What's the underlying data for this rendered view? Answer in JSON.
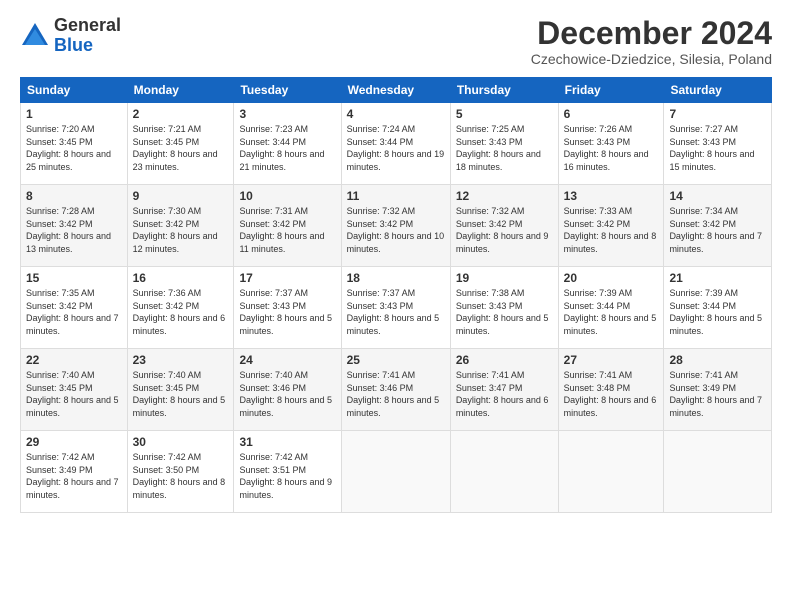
{
  "header": {
    "logo_general": "General",
    "logo_blue": "Blue",
    "month_title": "December 2024",
    "location": "Czechowice-Dziedzice, Silesia, Poland"
  },
  "days_of_week": [
    "Sunday",
    "Monday",
    "Tuesday",
    "Wednesday",
    "Thursday",
    "Friday",
    "Saturday"
  ],
  "weeks": [
    [
      {
        "day": "1",
        "sunrise": "Sunrise: 7:20 AM",
        "sunset": "Sunset: 3:45 PM",
        "daylight": "Daylight: 8 hours and 25 minutes."
      },
      {
        "day": "2",
        "sunrise": "Sunrise: 7:21 AM",
        "sunset": "Sunset: 3:45 PM",
        "daylight": "Daylight: 8 hours and 23 minutes."
      },
      {
        "day": "3",
        "sunrise": "Sunrise: 7:23 AM",
        "sunset": "Sunset: 3:44 PM",
        "daylight": "Daylight: 8 hours and 21 minutes."
      },
      {
        "day": "4",
        "sunrise": "Sunrise: 7:24 AM",
        "sunset": "Sunset: 3:44 PM",
        "daylight": "Daylight: 8 hours and 19 minutes."
      },
      {
        "day": "5",
        "sunrise": "Sunrise: 7:25 AM",
        "sunset": "Sunset: 3:43 PM",
        "daylight": "Daylight: 8 hours and 18 minutes."
      },
      {
        "day": "6",
        "sunrise": "Sunrise: 7:26 AM",
        "sunset": "Sunset: 3:43 PM",
        "daylight": "Daylight: 8 hours and 16 minutes."
      },
      {
        "day": "7",
        "sunrise": "Sunrise: 7:27 AM",
        "sunset": "Sunset: 3:43 PM",
        "daylight": "Daylight: 8 hours and 15 minutes."
      }
    ],
    [
      {
        "day": "8",
        "sunrise": "Sunrise: 7:28 AM",
        "sunset": "Sunset: 3:42 PM",
        "daylight": "Daylight: 8 hours and 13 minutes."
      },
      {
        "day": "9",
        "sunrise": "Sunrise: 7:30 AM",
        "sunset": "Sunset: 3:42 PM",
        "daylight": "Daylight: 8 hours and 12 minutes."
      },
      {
        "day": "10",
        "sunrise": "Sunrise: 7:31 AM",
        "sunset": "Sunset: 3:42 PM",
        "daylight": "Daylight: 8 hours and 11 minutes."
      },
      {
        "day": "11",
        "sunrise": "Sunrise: 7:32 AM",
        "sunset": "Sunset: 3:42 PM",
        "daylight": "Daylight: 8 hours and 10 minutes."
      },
      {
        "day": "12",
        "sunrise": "Sunrise: 7:32 AM",
        "sunset": "Sunset: 3:42 PM",
        "daylight": "Daylight: 8 hours and 9 minutes."
      },
      {
        "day": "13",
        "sunrise": "Sunrise: 7:33 AM",
        "sunset": "Sunset: 3:42 PM",
        "daylight": "Daylight: 8 hours and 8 minutes."
      },
      {
        "day": "14",
        "sunrise": "Sunrise: 7:34 AM",
        "sunset": "Sunset: 3:42 PM",
        "daylight": "Daylight: 8 hours and 7 minutes."
      }
    ],
    [
      {
        "day": "15",
        "sunrise": "Sunrise: 7:35 AM",
        "sunset": "Sunset: 3:42 PM",
        "daylight": "Daylight: 8 hours and 7 minutes."
      },
      {
        "day": "16",
        "sunrise": "Sunrise: 7:36 AM",
        "sunset": "Sunset: 3:42 PM",
        "daylight": "Daylight: 8 hours and 6 minutes."
      },
      {
        "day": "17",
        "sunrise": "Sunrise: 7:37 AM",
        "sunset": "Sunset: 3:43 PM",
        "daylight": "Daylight: 8 hours and 5 minutes."
      },
      {
        "day": "18",
        "sunrise": "Sunrise: 7:37 AM",
        "sunset": "Sunset: 3:43 PM",
        "daylight": "Daylight: 8 hours and 5 minutes."
      },
      {
        "day": "19",
        "sunrise": "Sunrise: 7:38 AM",
        "sunset": "Sunset: 3:43 PM",
        "daylight": "Daylight: 8 hours and 5 minutes."
      },
      {
        "day": "20",
        "sunrise": "Sunrise: 7:39 AM",
        "sunset": "Sunset: 3:44 PM",
        "daylight": "Daylight: 8 hours and 5 minutes."
      },
      {
        "day": "21",
        "sunrise": "Sunrise: 7:39 AM",
        "sunset": "Sunset: 3:44 PM",
        "daylight": "Daylight: 8 hours and 5 minutes."
      }
    ],
    [
      {
        "day": "22",
        "sunrise": "Sunrise: 7:40 AM",
        "sunset": "Sunset: 3:45 PM",
        "daylight": "Daylight: 8 hours and 5 minutes."
      },
      {
        "day": "23",
        "sunrise": "Sunrise: 7:40 AM",
        "sunset": "Sunset: 3:45 PM",
        "daylight": "Daylight: 8 hours and 5 minutes."
      },
      {
        "day": "24",
        "sunrise": "Sunrise: 7:40 AM",
        "sunset": "Sunset: 3:46 PM",
        "daylight": "Daylight: 8 hours and 5 minutes."
      },
      {
        "day": "25",
        "sunrise": "Sunrise: 7:41 AM",
        "sunset": "Sunset: 3:46 PM",
        "daylight": "Daylight: 8 hours and 5 minutes."
      },
      {
        "day": "26",
        "sunrise": "Sunrise: 7:41 AM",
        "sunset": "Sunset: 3:47 PM",
        "daylight": "Daylight: 8 hours and 6 minutes."
      },
      {
        "day": "27",
        "sunrise": "Sunrise: 7:41 AM",
        "sunset": "Sunset: 3:48 PM",
        "daylight": "Daylight: 8 hours and 6 minutes."
      },
      {
        "day": "28",
        "sunrise": "Sunrise: 7:41 AM",
        "sunset": "Sunset: 3:49 PM",
        "daylight": "Daylight: 8 hours and 7 minutes."
      }
    ],
    [
      {
        "day": "29",
        "sunrise": "Sunrise: 7:42 AM",
        "sunset": "Sunset: 3:49 PM",
        "daylight": "Daylight: 8 hours and 7 minutes."
      },
      {
        "day": "30",
        "sunrise": "Sunrise: 7:42 AM",
        "sunset": "Sunset: 3:50 PM",
        "daylight": "Daylight: 8 hours and 8 minutes."
      },
      {
        "day": "31",
        "sunrise": "Sunrise: 7:42 AM",
        "sunset": "Sunset: 3:51 PM",
        "daylight": "Daylight: 8 hours and 9 minutes."
      },
      null,
      null,
      null,
      null
    ]
  ]
}
